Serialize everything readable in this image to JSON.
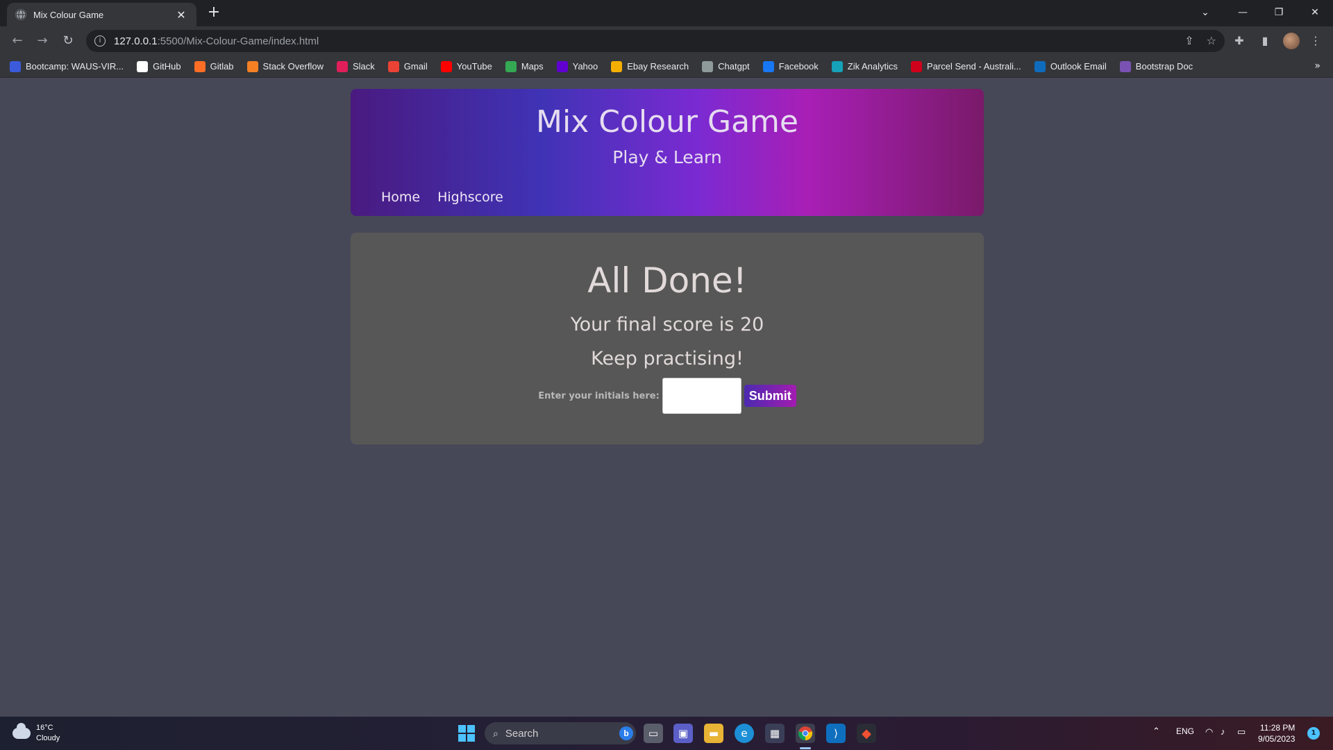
{
  "browser": {
    "tab_title": "Mix Colour Game",
    "url_host": "127.0.0.1",
    "url_path": ":5500/Mix-Colour-Game/index.html",
    "bookmarks": [
      {
        "label": "Bootcamp: WAUS-VIR...",
        "icon": "bootcamp-icon",
        "color": "#3b5bdb"
      },
      {
        "label": "GitHub",
        "icon": "github-icon",
        "color": "#ffffff"
      },
      {
        "label": "Gitlab",
        "icon": "gitlab-icon",
        "color": "#fc6d26"
      },
      {
        "label": "Stack Overflow",
        "icon": "stackoverflow-icon",
        "color": "#f48024"
      },
      {
        "label": "Slack",
        "icon": "slack-icon",
        "color": "#e01e5a"
      },
      {
        "label": "Gmail",
        "icon": "gmail-icon",
        "color": "#ea4335"
      },
      {
        "label": "YouTube",
        "icon": "youtube-icon",
        "color": "#ff0000"
      },
      {
        "label": "Maps",
        "icon": "maps-icon",
        "color": "#34a853"
      },
      {
        "label": "Yahoo",
        "icon": "yahoo-icon",
        "color": "#6001d2"
      },
      {
        "label": "Ebay Research",
        "icon": "ebay-icon",
        "color": "#f5af02"
      },
      {
        "label": "Chatgpt",
        "icon": "chatgpt-icon",
        "color": "#8e9a9a"
      },
      {
        "label": "Facebook",
        "icon": "facebook-icon",
        "color": "#1877f2"
      },
      {
        "label": "Zik Analytics",
        "icon": "zik-icon",
        "color": "#16a2b8"
      },
      {
        "label": "Parcel Send - Australi...",
        "icon": "parcel-icon",
        "color": "#d0021b"
      },
      {
        "label": "Outlook Email",
        "icon": "outlook-icon",
        "color": "#0f6cbd"
      },
      {
        "label": "Bootstrap Doc",
        "icon": "bootstrap-icon",
        "color": "#7952b3"
      }
    ]
  },
  "header": {
    "title": "Mix Colour Game",
    "subtitle": "Play & Learn",
    "nav": [
      "Home",
      "Highscore"
    ]
  },
  "result": {
    "heading": "All Done!",
    "score_text": "Your final score is 20",
    "message": "Keep practising!",
    "initials_label": "Enter your initials here:",
    "initials_value": "",
    "submit_label": "Submit"
  },
  "taskbar": {
    "weather_temp": "16°C",
    "weather_desc": "Cloudy",
    "search_label": "Search",
    "lang": "ENG",
    "time": "11:28 PM",
    "date": "9/05/2023",
    "notifications": "1"
  }
}
